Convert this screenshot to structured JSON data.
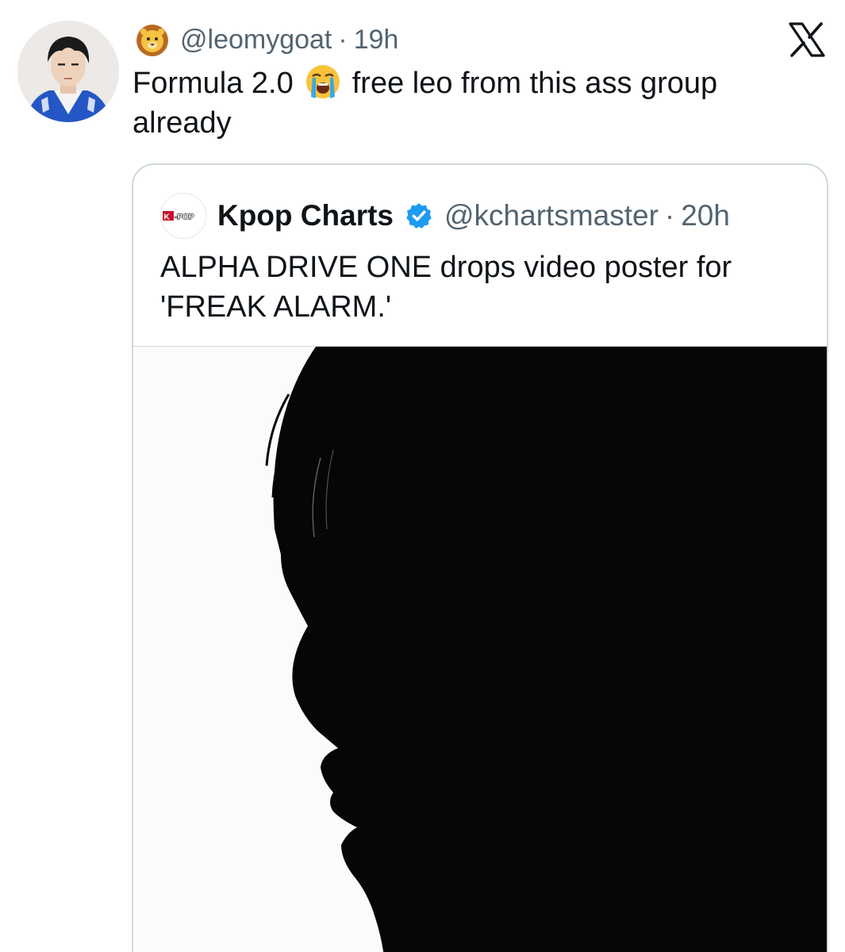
{
  "tweet": {
    "handle": "@leomygoat",
    "separator": "·",
    "time": "19h",
    "text_part1": "Formula 2.0",
    "text_part2": "free leo from this ass group already",
    "avatar_icon": "profile-photo",
    "handle_emoji": "lion-face-emoji",
    "text_emoji": "loudly-crying-face-emoji"
  },
  "brand_icon": "x-logo-icon",
  "quote": {
    "avatar_label": "K-POP",
    "name": "Kpop Charts",
    "verified_icon": "verified-badge-icon",
    "handle": "@kchartsmaster",
    "separator": "·",
    "time": "20h",
    "text": "ALPHA DRIVE ONE drops video poster for 'FREAK ALARM.'",
    "media": "profile-silhouette-image"
  },
  "colors": {
    "text_primary": "#0f1419",
    "text_secondary": "#536471",
    "border": "#cfd9de",
    "verified": "#1d9bf0"
  }
}
